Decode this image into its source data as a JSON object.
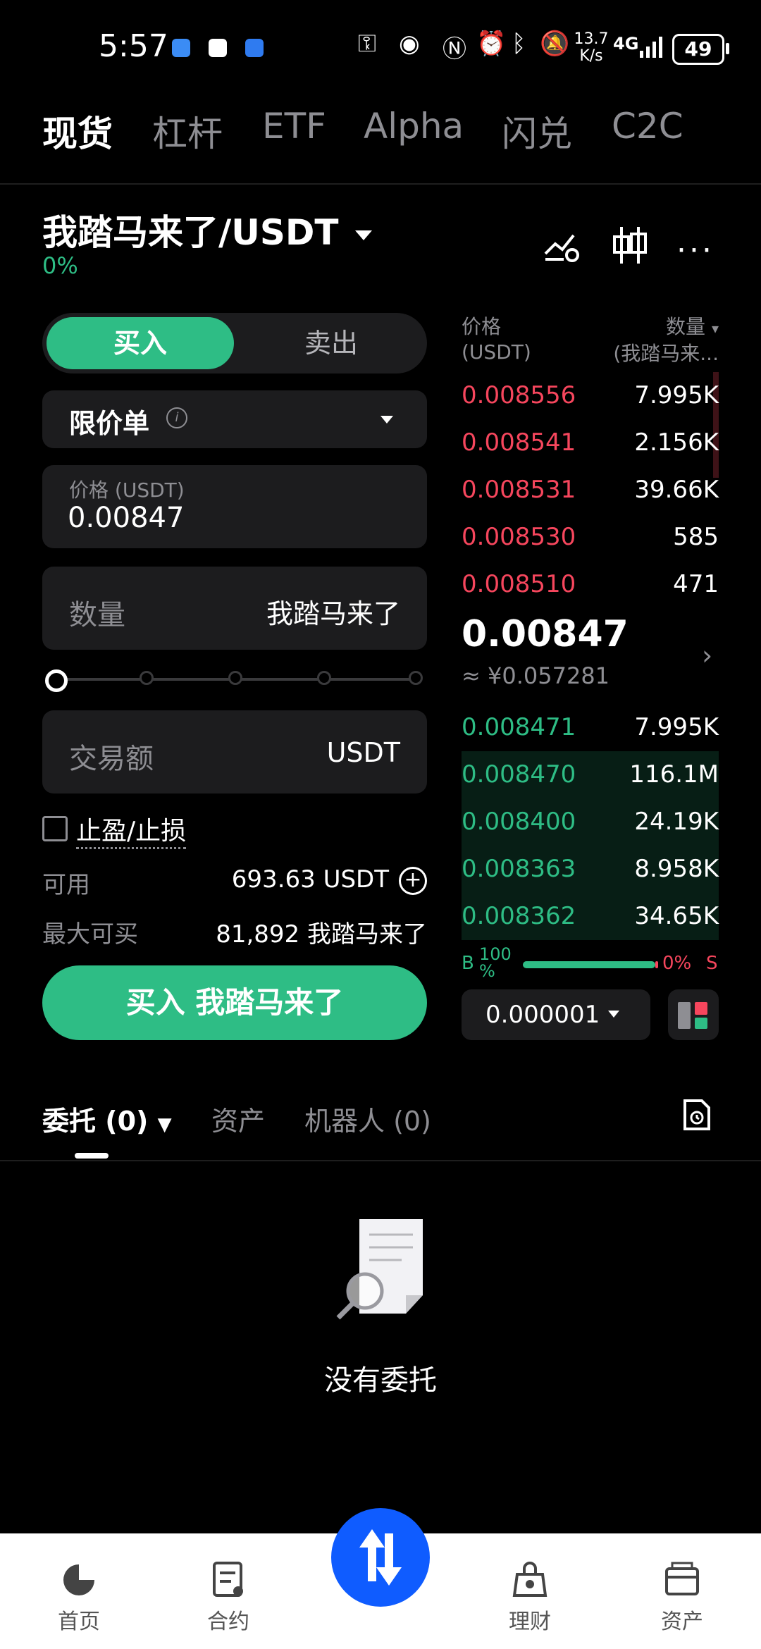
{
  "status_bar": {
    "time": "5:57",
    "net_speed": "13.7 K/s",
    "network": "4G",
    "battery": "49"
  },
  "tabs": [
    "现货",
    "杠杆",
    "ETF",
    "Alpha",
    "闪兑",
    "C2C"
  ],
  "pair": {
    "name": "我踏马来了/USDT",
    "change": "0%"
  },
  "order_form": {
    "buy_label": "买入",
    "sell_label": "卖出",
    "order_type": "限价单",
    "price_label": "价格 (USDT)",
    "price_value": "0.00847",
    "qty_placeholder": "数量",
    "qty_unit": "我踏马来了",
    "amount_placeholder": "交易额",
    "amount_unit": "USDT",
    "tp_sl": "止盈/止损",
    "available_label": "可用",
    "available_value": "693.63 USDT",
    "max_buy_label": "最大可买",
    "max_buy_value": "81,892 我踏马来了",
    "submit_label": "买入 我踏马来了"
  },
  "orderbook": {
    "price_header": "价格",
    "price_unit": "(USDT)",
    "qty_header": "数量",
    "qty_unit": "(我踏马来...",
    "asks": [
      {
        "price": "0.008556",
        "qty": "7.995K"
      },
      {
        "price": "0.008541",
        "qty": "2.156K"
      },
      {
        "price": "0.008531",
        "qty": "39.66K"
      },
      {
        "price": "0.008530",
        "qty": "585"
      },
      {
        "price": "0.008510",
        "qty": "471"
      }
    ],
    "last_price": "0.00847",
    "last_price_cny": "≈ ¥0.057281",
    "bids": [
      {
        "price": "0.008471",
        "qty": "7.995K"
      },
      {
        "price": "0.008470",
        "qty": "116.1M"
      },
      {
        "price": "0.008400",
        "qty": "24.19K"
      },
      {
        "price": "0.008363",
        "qty": "8.958K"
      },
      {
        "price": "0.008362",
        "qty": "34.65K"
      }
    ],
    "buy_ratio_label": "B",
    "buy_ratio": "100 %",
    "sell_ratio": "0%",
    "sell_ratio_label": "S",
    "step": "0.000001"
  },
  "bottom_tabs": {
    "orders": "委托 (0)",
    "assets": "资产",
    "bots": "机器人 (0)"
  },
  "empty_text": "没有委托",
  "nav": [
    "首页",
    "合约",
    "理财",
    "资产"
  ],
  "colors": {
    "green": "#2ebd85",
    "red": "#f6465d",
    "fab": "#0f5cff"
  }
}
